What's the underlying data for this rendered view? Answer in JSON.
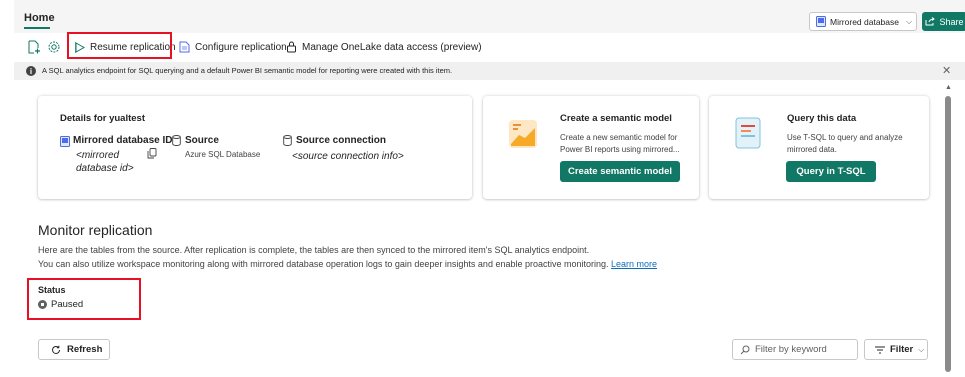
{
  "header": {
    "home_tab": "Home",
    "item_type_dropdown": "Mirrored database",
    "share_label": "Share"
  },
  "toolbar": {
    "resume_label": "Resume replication",
    "configure_label": "Configure replication",
    "manage_label": "Manage OneLake data access (preview)"
  },
  "info_bar": {
    "message": "A SQL analytics endpoint for SQL querying and a default Power BI semantic model for reporting were created with this item."
  },
  "details_card": {
    "title": "Details for yualtest",
    "db_id_label": "Mirrored database ID",
    "db_id_value_line1": "<mirrored",
    "db_id_value_line2": "database id>",
    "source_label": "Source",
    "source_value": "Azure SQL Database",
    "connection_label": "Source connection",
    "connection_value": "<source connection info>"
  },
  "semantic_card": {
    "title": "Create a semantic model",
    "desc_line1": "Create a new semantic model for",
    "desc_line2": "Power BI reports using mirrored...",
    "button": "Create semantic model"
  },
  "query_card": {
    "title": "Query this data",
    "desc_line1": "Use T-SQL to query and analyze",
    "desc_line2": "mirrored data.",
    "button": "Query in T-SQL"
  },
  "monitor": {
    "title": "Monitor replication",
    "desc_line1": "Here are the tables from the source. After replication is complete, the tables are then synced to the mirrored item's SQL analytics endpoint.",
    "desc_line2": "You can also utilize workspace monitoring along with mirrored database operation logs to gain deeper insights and enable proactive monitoring.",
    "learn_more": "Learn more",
    "status_label": "Status",
    "status_value": "Paused",
    "refresh_label": "Refresh",
    "filter_placeholder": "Filter by keyword",
    "filter_label": "Filter"
  },
  "colors": {
    "accent": "#117865",
    "highlight_box": "#e81123",
    "link": "#0f6cbd"
  }
}
